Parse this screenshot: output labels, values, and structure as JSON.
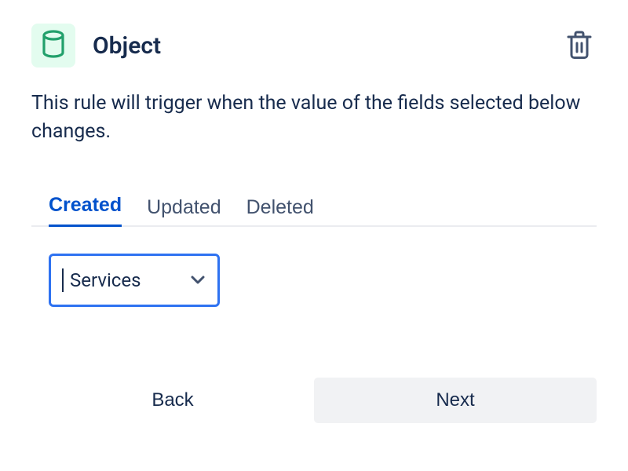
{
  "header": {
    "title": "Object",
    "icon_name": "cylinder-icon",
    "delete_label": "Delete"
  },
  "description": "This rule will trigger when the value of the fields selected below changes.",
  "tabs": [
    {
      "label": "Created",
      "active": true
    },
    {
      "label": "Updated",
      "active": false
    },
    {
      "label": "Deleted",
      "active": false
    }
  ],
  "type_select": {
    "value": "Services"
  },
  "footer": {
    "back_label": "Back",
    "next_label": "Next"
  },
  "colors": {
    "accent": "#0052CC",
    "icon_bg": "#E3FCEF",
    "icon_stroke": "#22A06B",
    "text": "#172B4D",
    "muted": "#42526E",
    "select_border": "#2E72F1",
    "next_bg": "#F1F2F4"
  }
}
